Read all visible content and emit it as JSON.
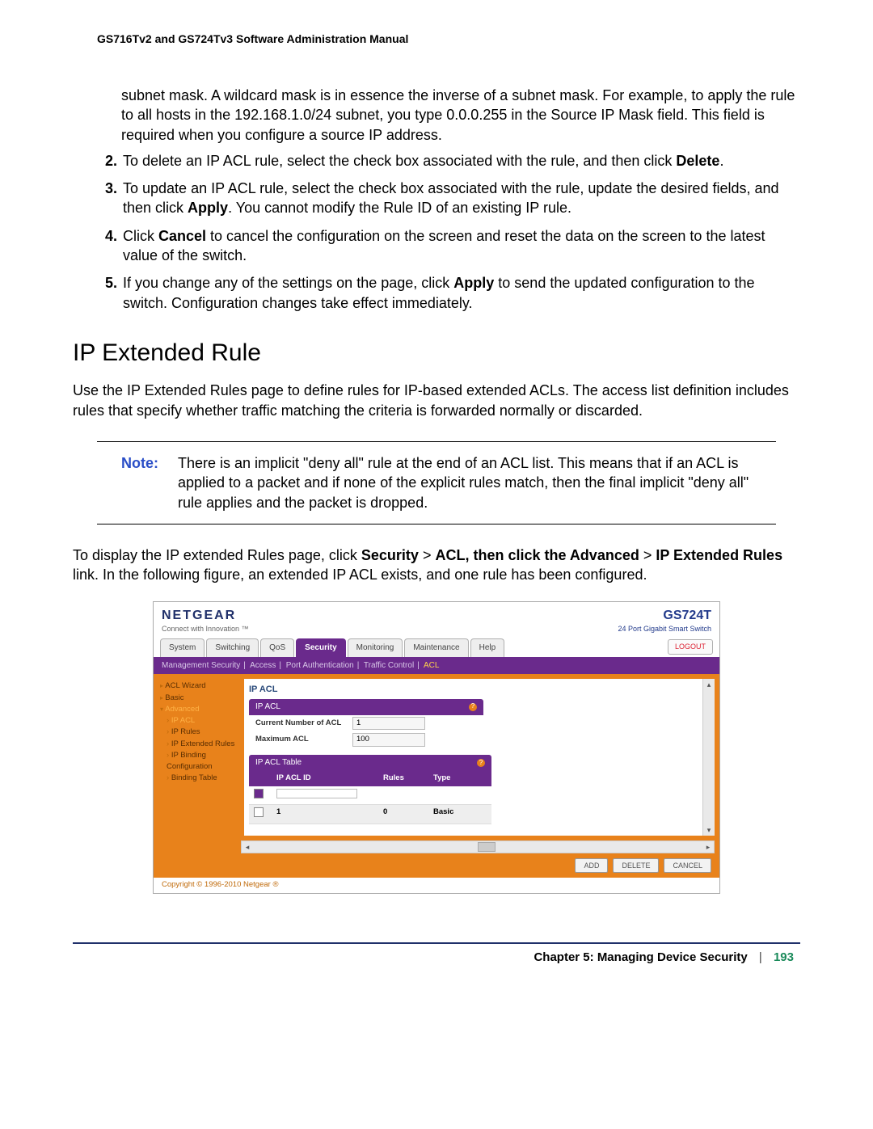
{
  "header": "GS716Tv2 and GS724Tv3 Software Administration Manual",
  "continuation": "subnet mask. A wildcard mask is in essence the inverse of a subnet mask. For example, to apply the rule to all hosts in the 192.168.1.0/24 subnet, you type 0.0.0.255 in the Source IP Mask field. This field is required when you configure a source IP address.",
  "step2_a": "To delete an IP ACL rule, select the check box associated with the rule, and then click ",
  "step2_b": "Delete",
  "step2_c": ".",
  "step3_a": "To update an IP ACL rule, select the check box associated with the rule, update the desired fields, and then click ",
  "step3_b": "Apply",
  "step3_c": ". You cannot modify the Rule ID of an existing IP rule.",
  "step4_a": "Click ",
  "step4_b": "Cancel",
  "step4_c": " to cancel the configuration on the screen and reset the data on the screen to the latest value of the switch.",
  "step5_a": "If you change any of the settings on the page, click ",
  "step5_b": "Apply",
  "step5_c": " to send the updated configuration to the switch. Configuration changes take effect immediately.",
  "section_title": "IP Extended Rule",
  "section_intro": "Use the IP Extended Rules page to define rules for IP-based extended ACLs. The access list definition includes rules that specify whether traffic matching the criteria is forwarded normally or discarded.",
  "note_label": "Note:",
  "note_text": "There is an implicit \"deny all\" rule at the end of an ACL list. This means that if an ACL is applied to a packet and if none of the explicit rules match, then the final implicit \"deny all\" rule applies and the packet is dropped.",
  "display_a": "To display the IP extended Rules page, click ",
  "display_b": "Security",
  "display_gt1": " > ",
  "display_c": "ACL, then click the Advanced",
  "display_gt2": " > ",
  "display_d": "IP Extended Rules",
  "display_e": " link. In the following figure, an extended IP ACL exists, and one rule has been configured.",
  "ui": {
    "brand": "NETGEAR",
    "tagline": "Connect with Innovation ™",
    "model": "GS724T",
    "modeldesc": "24 Port Gigabit Smart Switch",
    "tabs": [
      "System",
      "Switching",
      "QoS",
      "Security",
      "Monitoring",
      "Maintenance",
      "Help"
    ],
    "active_tab": "Security",
    "logout": "LOGOUT",
    "subnav": [
      "Management Security",
      "Access",
      "Port Authentication",
      "Traffic Control",
      "ACL"
    ],
    "subnav_active": "ACL",
    "sidebar": {
      "s0": "ACL Wizard",
      "s1": "Basic",
      "s2": "Advanced",
      "s3": "IP ACL",
      "s4": "IP Rules",
      "s5": "IP Extended Rules",
      "s6": "IP Binding Configuration",
      "s7": "Binding Table"
    },
    "main_title": "IP ACL",
    "panel1_title": "IP ACL",
    "field1_label": "Current Number of ACL",
    "field1_value": "1",
    "field2_label": "Maximum ACL",
    "field2_value": "100",
    "panel2_title": "IP ACL Table",
    "th_id": "IP ACL ID",
    "th_rules": "Rules",
    "th_type": "Type",
    "row_id": "1",
    "row_rules": "0",
    "row_type": "Basic",
    "btn_add": "ADD",
    "btn_delete": "DELETE",
    "btn_cancel": "CANCEL",
    "copyright": "Copyright © 1996-2010 Netgear ®"
  },
  "footer": {
    "chapter": "Chapter 5:  Managing Device Security",
    "page": "193"
  }
}
